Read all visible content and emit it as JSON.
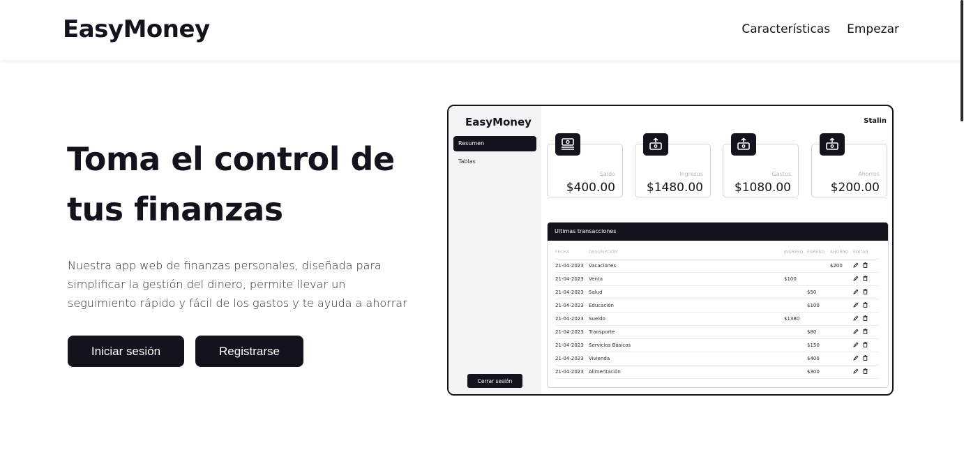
{
  "header": {
    "brand": "EasyMoney",
    "nav": [
      "Características",
      "Empezar"
    ]
  },
  "hero": {
    "title": "Toma el control de tus finanzas",
    "description": "Nuestra app web de finanzas personales, diseñada para simplificar la gestión del dinero, permite llevar un seguimiento rápido y fácil de los gastos y te ayuda a ahorrar",
    "login_label": "Iniciar sesión",
    "register_label": "Registrarse"
  },
  "preview": {
    "brand": "EasyMoney",
    "user": "Stalin",
    "menu": [
      "Resumen",
      "Tablas"
    ],
    "logout_label": "Cerrar sesión",
    "cards": [
      {
        "label": "Saldo",
        "value": "$400.00",
        "icon": "money-icon"
      },
      {
        "label": "Ingresos",
        "value": "$1480.00",
        "icon": "income-icon"
      },
      {
        "label": "Gastos",
        "value": "$1080.00",
        "icon": "expense-icon"
      },
      {
        "label": "Ahorros",
        "value": "$200.00",
        "icon": "savings-icon"
      }
    ],
    "transactions": {
      "title": "Ultimas transacciones",
      "columns": [
        "FECHA",
        "DESCRIPCIÓN",
        "INGRESO",
        "EGRESO",
        "AHORRO",
        "EDITAR"
      ],
      "rows": [
        {
          "fecha": "21-04-2023",
          "descripcion": "Vacaciones",
          "ingreso": "",
          "egreso": "",
          "ahorro": "$200"
        },
        {
          "fecha": "21-04-2023",
          "descripcion": "Venta",
          "ingreso": "$100",
          "egreso": "",
          "ahorro": ""
        },
        {
          "fecha": "21-04-2023",
          "descripcion": "Salud",
          "ingreso": "",
          "egreso": "$50",
          "ahorro": ""
        },
        {
          "fecha": "21-04-2023",
          "descripcion": "Educación",
          "ingreso": "",
          "egreso": "$100",
          "ahorro": ""
        },
        {
          "fecha": "21-04-2023",
          "descripcion": "Sueldo",
          "ingreso": "$1380",
          "egreso": "",
          "ahorro": ""
        },
        {
          "fecha": "21-04-2023",
          "descripcion": "Transporte",
          "ingreso": "",
          "egreso": "$80",
          "ahorro": ""
        },
        {
          "fecha": "21-04-2023",
          "descripcion": "Servicios Básicos",
          "ingreso": "",
          "egreso": "$150",
          "ahorro": ""
        },
        {
          "fecha": "21-04-2023",
          "descripcion": "Vivienda",
          "ingreso": "",
          "egreso": "$400",
          "ahorro": ""
        },
        {
          "fecha": "21-04-2023",
          "descripcion": "Alimentación",
          "ingreso": "",
          "egreso": "$300",
          "ahorro": ""
        }
      ]
    }
  },
  "colors": {
    "primary": "#14121d",
    "sidebar_bg": "#f4f3f5",
    "muted_text": "#b9b8bf"
  }
}
